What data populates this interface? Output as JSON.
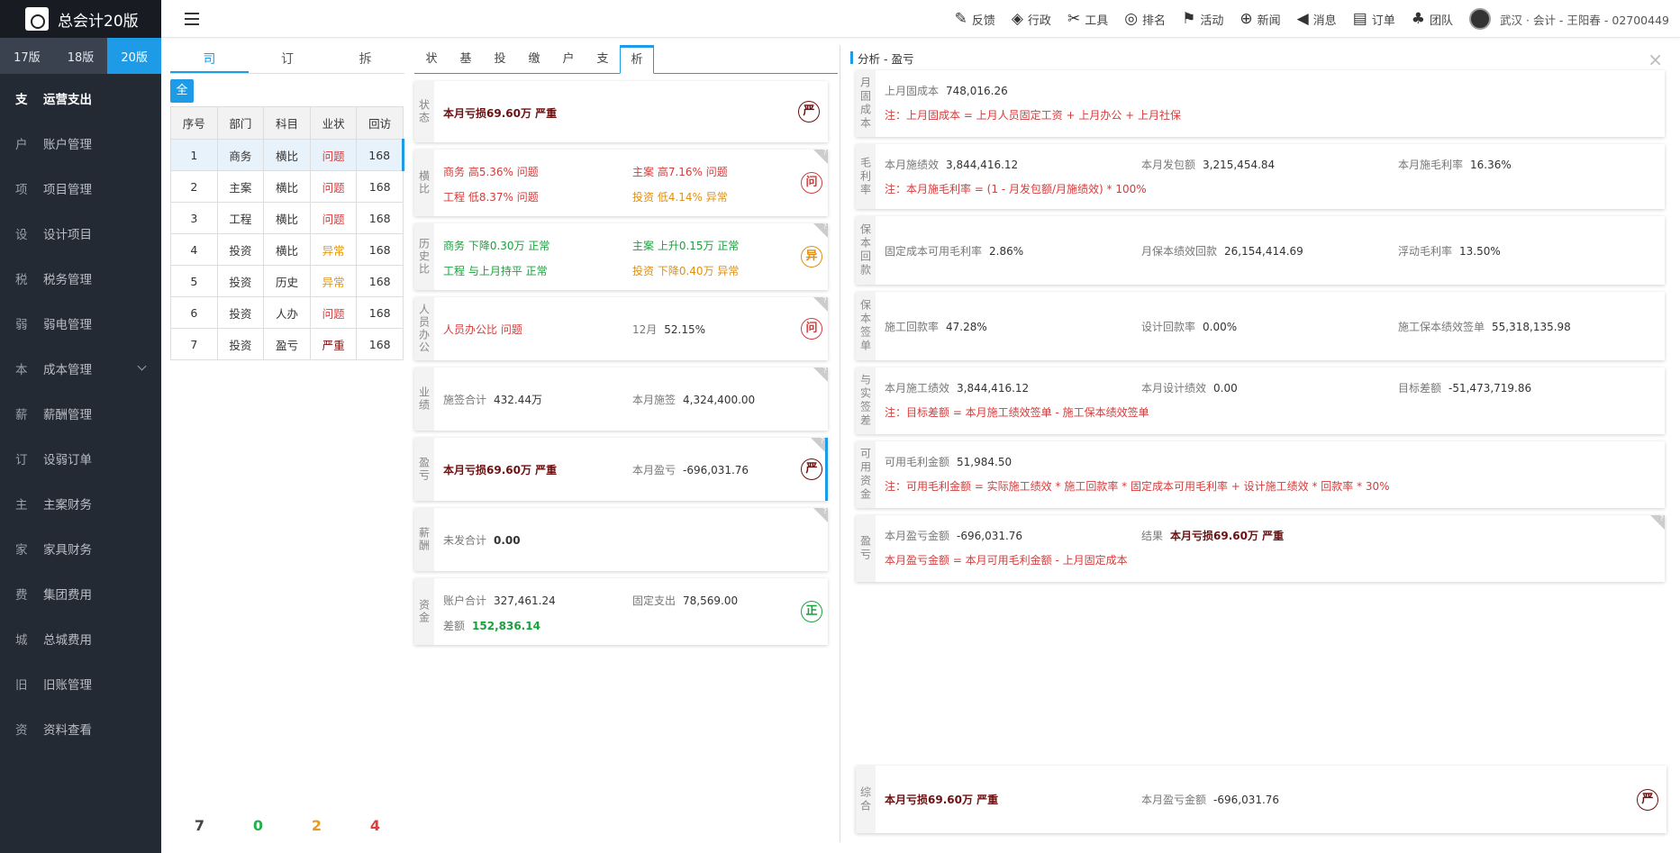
{
  "brand": {
    "title": "总会计20版"
  },
  "versions": [
    {
      "label": "17版"
    },
    {
      "label": "18版"
    },
    {
      "label": "20版"
    }
  ],
  "menu": [
    {
      "ch": "支",
      "label": "运营支出"
    },
    {
      "ch": "户",
      "label": "账户管理"
    },
    {
      "ch": "项",
      "label": "项目管理"
    },
    {
      "ch": "设",
      "label": "设计项目"
    },
    {
      "ch": "税",
      "label": "税务管理"
    },
    {
      "ch": "弱",
      "label": "弱电管理"
    },
    {
      "ch": "本",
      "label": "成本管理"
    },
    {
      "ch": "薪",
      "label": "薪酬管理"
    },
    {
      "ch": "订",
      "label": "设弱订单"
    },
    {
      "ch": "主",
      "label": "主案财务"
    },
    {
      "ch": "家",
      "label": "家具财务"
    },
    {
      "ch": "费",
      "label": "集团费用"
    },
    {
      "ch": "城",
      "label": "总城费用"
    },
    {
      "ch": "旧",
      "label": "旧账管理"
    },
    {
      "ch": "资",
      "label": "资料查看"
    }
  ],
  "topnav": [
    {
      "icon": "✎",
      "label": "反馈"
    },
    {
      "icon": "◈",
      "label": "行政"
    },
    {
      "icon": "✂",
      "label": "工具"
    },
    {
      "icon": "◎",
      "label": "排名"
    },
    {
      "icon": "⚑",
      "label": "活动"
    },
    {
      "icon": "⊕",
      "label": "新闻"
    },
    {
      "icon": "◀",
      "label": "消息"
    },
    {
      "icon": "▤",
      "label": "订单"
    },
    {
      "icon": "♣",
      "label": "团队"
    }
  ],
  "user": {
    "text": "武汉 · 会计 - 王阳春 - 02700449"
  },
  "panel1": {
    "tabs": [
      "司",
      "订",
      "拆"
    ],
    "all_label": "全",
    "headers": [
      "序号",
      "部门",
      "科目",
      "业状",
      "回访"
    ],
    "rows": [
      {
        "no": "1",
        "dept": "商务",
        "subj": "横比",
        "status": "问题",
        "visit": "168"
      },
      {
        "no": "2",
        "dept": "主案",
        "subj": "横比",
        "status": "问题",
        "visit": "168"
      },
      {
        "no": "3",
        "dept": "工程",
        "subj": "横比",
        "status": "问题",
        "visit": "168"
      },
      {
        "no": "4",
        "dept": "投资",
        "subj": "横比",
        "status": "异常",
        "visit": "168"
      },
      {
        "no": "5",
        "dept": "投资",
        "subj": "历史",
        "status": "异常",
        "visit": "168"
      },
      {
        "no": "6",
        "dept": "投资",
        "subj": "人办",
        "status": "问题",
        "visit": "168"
      },
      {
        "no": "7",
        "dept": "投资",
        "subj": "盈亏",
        "status": "严重",
        "visit": "168"
      }
    ],
    "counts": [
      "7",
      "0",
      "2",
      "4"
    ]
  },
  "panel2": {
    "tabs": [
      "状",
      "基",
      "投",
      "缴",
      "户",
      "支",
      "析"
    ],
    "cards": {
      "state": {
        "label": "状态",
        "text": "本月亏损69.60万 严重",
        "badge": "严"
      },
      "horiz": {
        "label": "横比",
        "a": "商务 高5.36% 问题",
        "b": "主案 高7.16% 问题",
        "c": "工程 低8.37% 问题",
        "d": "投资 低4.14% 异常",
        "badge": "问"
      },
      "hist": {
        "label": "历史比",
        "a": "商务 下降0.30万 正常",
        "b": "主案 上升0.15万 正常",
        "c": "工程 与上月持平 正常",
        "d": "投资 下降0.40万 异常",
        "badge": "异"
      },
      "staff": {
        "label": "人员办公",
        "a": "人员办公比 问题",
        "month": "12月",
        "pct": "52.15%",
        "badge": "问"
      },
      "perf": {
        "label": "业绩",
        "k1": "施签合计",
        "v1": "432.44万",
        "k2": "本月施签",
        "v2": "4,324,400.00"
      },
      "pl": {
        "label": "盈亏",
        "text": "本月亏损69.60万 严重",
        "k2": "本月盈亏",
        "v2": "-696,031.76",
        "badge": "严"
      },
      "salary": {
        "label": "薪酬",
        "k1": "未发合计",
        "v1": "0.00"
      },
      "fund": {
        "label": "资金",
        "k1": "账户合计",
        "v1": "327,461.24",
        "k2": "固定支出",
        "v2": "78,569.00",
        "k3": "差额",
        "v3": "152,836.14",
        "badge": "正"
      }
    }
  },
  "panel3": {
    "title": "分析 - 盈亏",
    "close": "×",
    "sections": {
      "fixed": {
        "label": "月固成本",
        "k1": "上月固成本",
        "v1": "748,016.26",
        "note": "注：上月固成本 = 上月人员固定工资 + 上月办公 + 上月社保"
      },
      "gross": {
        "label": "毛利率",
        "k1": "本月施绩效",
        "v1": "3,844,416.12",
        "k2": "本月发包额",
        "v2": "3,215,454.84",
        "k3": "本月施毛利率",
        "v3": "16.36%",
        "note": "注：本月施毛利率 = (1 - 月发包额/月施绩效) * 100%"
      },
      "protect": {
        "label": "保本回款",
        "k1": "固定成本可用毛利率",
        "v1": "2.86%",
        "k2": "月保本绩效回款",
        "v2": "26,154,414.69",
        "k3": "浮动毛利率",
        "v3": "13.50%"
      },
      "sign": {
        "label": "保本签单",
        "k1": "施工回款率",
        "v1": "47.28%",
        "k2": "设计回款率",
        "v2": "0.00%",
        "k3": "施工保本绩效签单",
        "v3": "55,318,135.98"
      },
      "gap": {
        "label": "与实签差",
        "k1": "本月施工绩效",
        "v1": "3,844,416.12",
        "k2": "本月设计绩效",
        "v2": "0.00",
        "k3": "目标差额",
        "v3": "-51,473,719.86",
        "note": "注：目标差额 = 本月施工绩效签单 - 施工保本绩效签单"
      },
      "avail": {
        "label": "可用资金",
        "k1": "可用毛利金额",
        "v1": "51,984.50",
        "note": "注：可用毛利金额 = 实际施工绩效 * 施工回款率 * 固定成本可用毛利率 + 设计施工绩效 * 回款率 * 30%"
      },
      "pl": {
        "label": "盈亏",
        "k1": "本月盈亏金额",
        "v1": "-696,031.76",
        "k2": "结果",
        "v2": "本月亏损69.60万 严重",
        "note": "本月盈亏金额 = 本月可用毛利金额 - 上月固定成本"
      }
    },
    "summary": {
      "label": "综合",
      "text": "本月亏损69.60万 严重",
      "k2": "本月盈亏金额",
      "v2": "-696,031.76",
      "badge": "严"
    }
  }
}
